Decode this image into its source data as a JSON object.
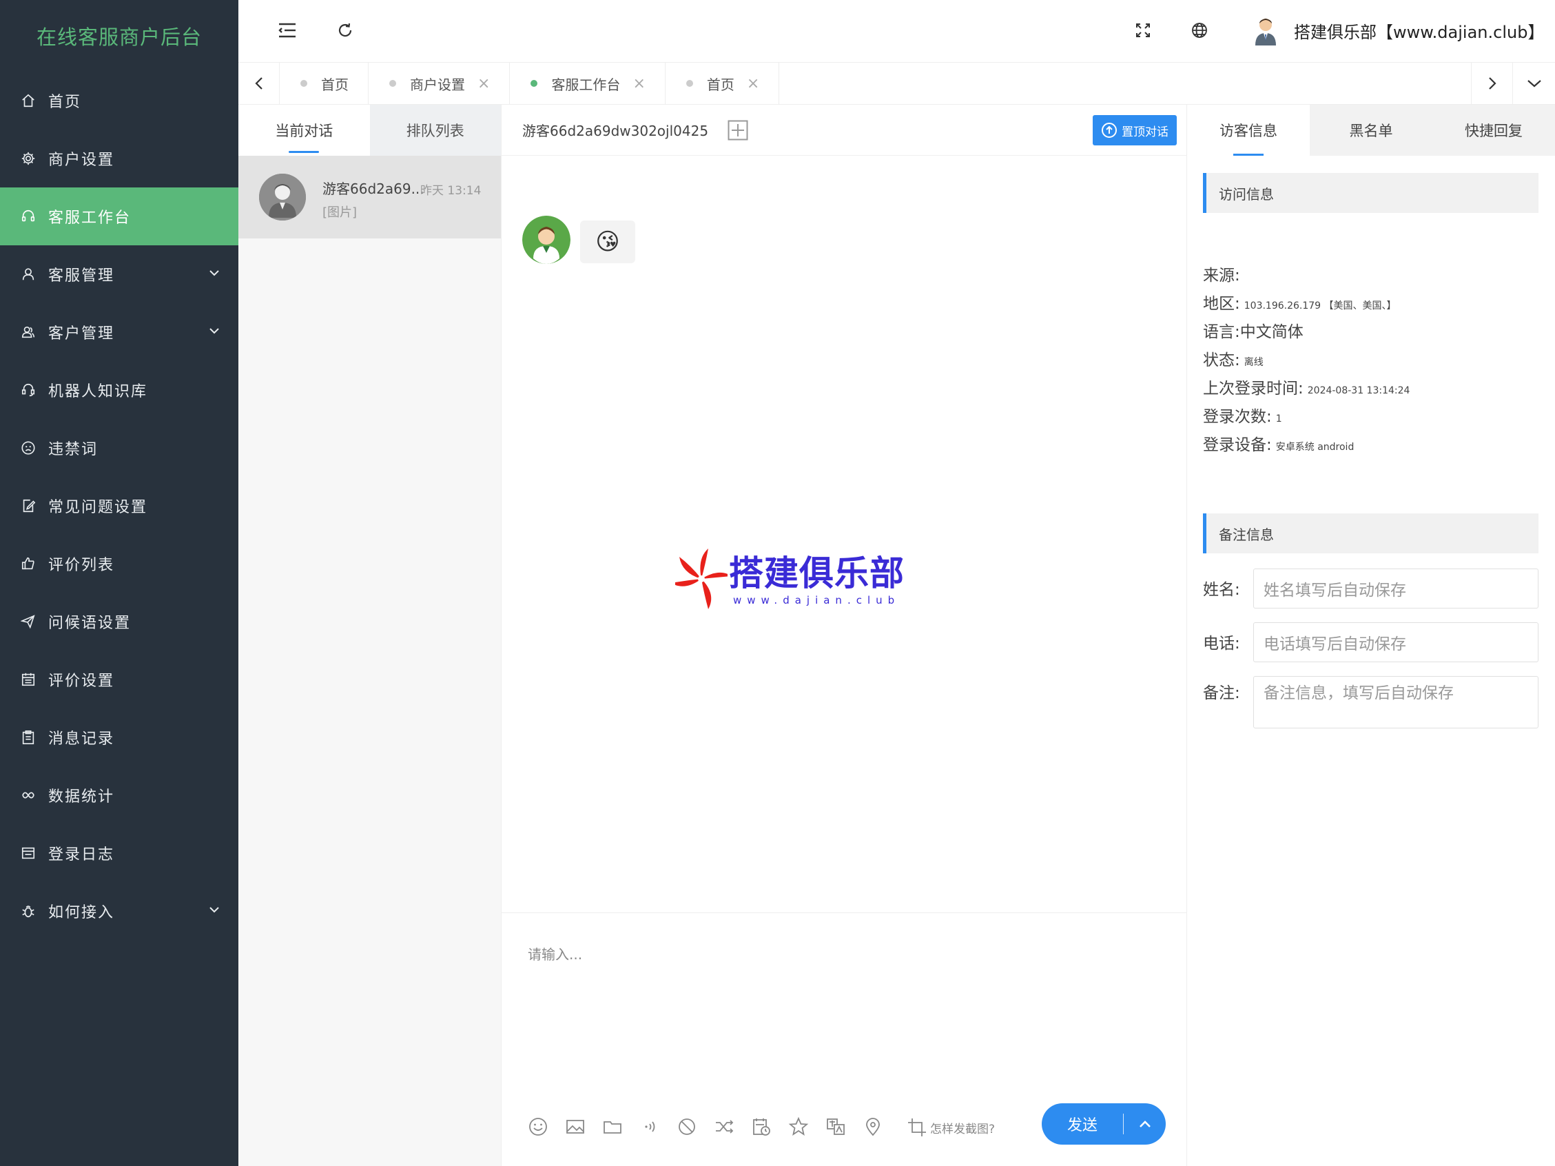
{
  "brand": "在线客服商户后台",
  "sidebar": {
    "items": [
      {
        "label": "首页",
        "icon": "home-icon"
      },
      {
        "label": "商户设置",
        "icon": "gear-icon"
      },
      {
        "label": "客服工作台",
        "icon": "headset-icon",
        "active": true
      },
      {
        "label": "客服管理",
        "icon": "user-icon",
        "expandable": true
      },
      {
        "label": "客户管理",
        "icon": "users-icon",
        "expandable": true
      },
      {
        "label": "机器人知识库",
        "icon": "robot-icon"
      },
      {
        "label": "违禁词",
        "icon": "frown-icon"
      },
      {
        "label": "常见问题设置",
        "icon": "edit-doc-icon"
      },
      {
        "label": "评价列表",
        "icon": "thumb-up-icon"
      },
      {
        "label": "问候语设置",
        "icon": "send-icon"
      },
      {
        "label": "评价设置",
        "icon": "calendar-icon"
      },
      {
        "label": "消息记录",
        "icon": "clipboard-icon"
      },
      {
        "label": "数据统计",
        "icon": "infinity-icon"
      },
      {
        "label": "登录日志",
        "icon": "window-icon"
      },
      {
        "label": "如何接入",
        "icon": "bug-icon",
        "expandable": true
      }
    ]
  },
  "header": {
    "user_name": "搭建俱乐部【www.dajian.club】"
  },
  "tabs": [
    {
      "label": "首页",
      "closable": false,
      "active": false
    },
    {
      "label": "商户设置",
      "closable": true,
      "active": false
    },
    {
      "label": "客服工作台",
      "closable": true,
      "active": true
    },
    {
      "label": "首页",
      "closable": true,
      "active": false
    }
  ],
  "conversations": {
    "tabs": [
      "当前对话",
      "排队列表"
    ],
    "items": [
      {
        "name": "游客66d2a69...",
        "time": "昨天 13:14",
        "preview": "[图片]"
      }
    ]
  },
  "chat": {
    "title": "游客66d2a69dw302ojl0425",
    "pin_label": "置顶对话",
    "message_emoji": "😘",
    "watermark": {
      "title": "搭建俱乐部",
      "subtitle": "www.dajian.club"
    },
    "input_placeholder": "请输入...",
    "crop_hint": "怎样发截图?",
    "send_label": "发送",
    "tools": [
      "emoji-icon",
      "image-icon",
      "folder-icon",
      "voice-icon",
      "block-icon",
      "transfer-icon",
      "calendar-clock-icon",
      "star-icon",
      "translate-icon",
      "location-icon"
    ]
  },
  "info": {
    "tabs": [
      "访客信息",
      "黑名单",
      "快捷回复"
    ],
    "visit_section": "访问信息",
    "rows": [
      {
        "label": "来源:",
        "value": ""
      },
      {
        "label": "地区:",
        "value": "103.196.26.179 【美国、美国、】"
      },
      {
        "label": "语言:",
        "value": "中文简体",
        "big": true
      },
      {
        "label": "状态:",
        "value": "离线"
      },
      {
        "label": "上次登录时间:",
        "value": "2024-08-31 13:14:24"
      },
      {
        "label": "登录次数:",
        "value": "1"
      },
      {
        "label": "登录设备:",
        "value": "安卓系统 android"
      }
    ],
    "note_section": "备注信息",
    "form": {
      "name_label": "姓名:",
      "name_placeholder": "姓名填写后自动保存",
      "phone_label": "电话:",
      "phone_placeholder": "电话填写后自动保存",
      "note_label": "备注:",
      "note_placeholder": "备注信息，填写后自动保存"
    }
  },
  "colors": {
    "sidebar_bg": "#28323d",
    "accent_green": "#5ab87a",
    "primary_blue": "#2d8cf0"
  }
}
